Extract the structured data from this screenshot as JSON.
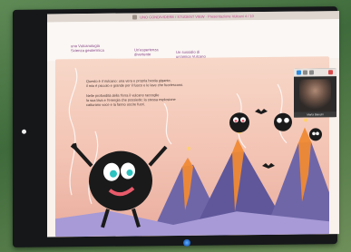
{
  "window": {
    "title": "UNO CONDIVIDERE / STUDENT VIEW · Presentazione Vulcani 4 / 10"
  },
  "links": [
    "una Vulcanologia",
    "Scienza geotermica",
    "Un'esperienza",
    "divertente",
    "Un sussidio di",
    "un'amica Vulcano"
  ],
  "content": {
    "para1": [
      "Questo è il Vulcano: una vera e propria bestia gigante,",
      "il mio è piccolo e grande per il fuoco e le lave che fuoriescono."
    ],
    "para2": [
      "Nelle profondità della Terra il vulcano raccoglie",
      "la sua lava e l'energia che possiede; la stessa esplosione",
      "catturano voce e la fanno uscire fuori."
    ]
  },
  "video": {
    "participant_name": "Marta Bianchi"
  },
  "colors": {
    "wall": "#4f7a45",
    "bezel": "#151719",
    "scene_bg": "#f3c3b3",
    "accent": "#c34a8a",
    "volcano": "#6f66a8",
    "lava": "#f08a34"
  },
  "icons": {
    "character_main": "black-blob-character",
    "characters_small": "small-black-creature",
    "bat": "bat-icon"
  }
}
